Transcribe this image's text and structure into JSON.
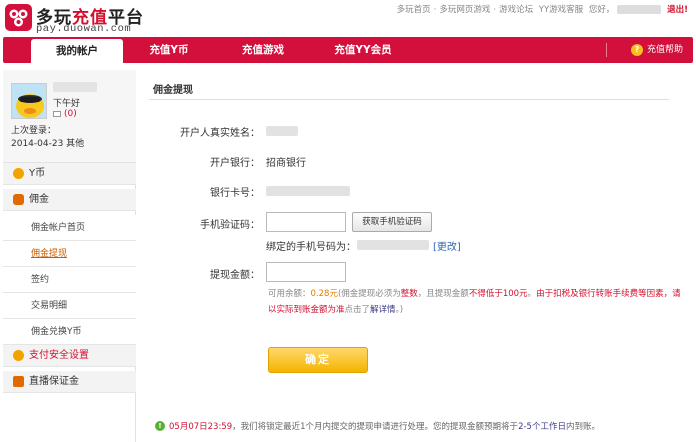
{
  "header": {
    "brand_cn_prefix": "多玩",
    "brand_cn_highlight": "充值",
    "brand_cn_suffix": "平台",
    "brand_en": "pay.duowan.com",
    "topnav": [
      "多玩首页",
      "·",
      "多玩网页游戏",
      "·",
      "游戏论坛",
      "YY游戏客服"
    ],
    "logout_label": "退出!"
  },
  "nav": {
    "tabs": [
      "我的帐户",
      "充值Y币",
      "充值游戏",
      "充值YY会员"
    ],
    "active_index": 0,
    "help_label": "充值帮助"
  },
  "sidebar": {
    "greeting": "下午好",
    "message_count": "(0)",
    "last_login_label": "上次登录：",
    "last_login_value": "2014-04-23 其他",
    "items": [
      {
        "label": "Y币",
        "kind": "group",
        "icon": "coin-icon",
        "icon_color": "#f2a300"
      },
      {
        "label": "佣金",
        "kind": "group",
        "icon": "money-bag-icon",
        "icon_color": "#e06a00"
      },
      {
        "label": "佣金帐户首页",
        "kind": "sub"
      },
      {
        "label": "佣金提现",
        "kind": "sub",
        "current": true
      },
      {
        "label": "签约",
        "kind": "sub"
      },
      {
        "label": "交易明细",
        "kind": "sub"
      },
      {
        "label": "佣金兑换Y币",
        "kind": "sub"
      },
      {
        "label": "支付安全设置",
        "kind": "group",
        "strong": true,
        "icon": "security-icon",
        "icon_color": "#f2a300"
      },
      {
        "label": "直播保证金",
        "kind": "group",
        "icon": "deposit-icon",
        "icon_color": "#e06a00"
      }
    ]
  },
  "main": {
    "title": "佣金提现",
    "fields": {
      "real_name_label": "开户人真实姓名：",
      "bank_label": "开户银行：",
      "bank_value": "招商银行",
      "card_label": "银行卡号：",
      "code_label": "手机验证码：",
      "code_value": "",
      "get_code_label": "获取手机验证码",
      "bound_phone_label": "绑定的手机号码为：",
      "change_label": "[更改]",
      "amount_label": "提现金额：",
      "amount_value": ""
    },
    "hint": {
      "p1": "可用余额：",
      "balance": "0.28元",
      "p2": "(佣金提现必须为",
      "whole": "整数",
      "p3": "，且提现金额",
      "min": "不得低于100元",
      "p4": "。",
      "fee": "由于扣税及银行转账手续费等因素，请以实际到账金额为准",
      "p5": "点击了",
      "detail": "解详情",
      "p6": "。)"
    },
    "confirm_label": "确定",
    "notice": {
      "time": "05月07日23:59",
      "p1": "，我们将锁定最近1个月内提交的提现申请进行处理。您的提现金额预期将于",
      "days": "2-5个工作日",
      "p2": "内到账。"
    }
  },
  "colors": {
    "brand_red": "#d30f3b",
    "accent_yellow": "#f4b400",
    "link_blue": "#2f66b3"
  }
}
